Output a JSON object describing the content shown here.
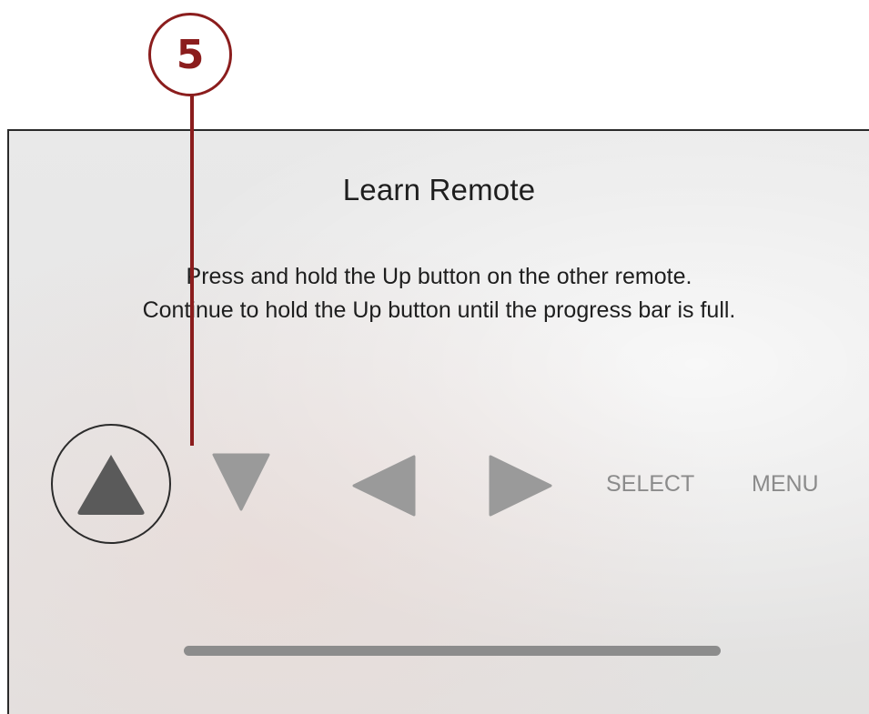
{
  "callout": {
    "number": "5"
  },
  "screen": {
    "title": "Learn Remote",
    "instructions": [
      "Press and hold the Up button on the other remote.",
      "Continue to hold the Up button until the progress bar is full."
    ]
  },
  "controls": {
    "items": [
      {
        "name": "up",
        "icon": "up-triangle-icon",
        "state": "active"
      },
      {
        "name": "down",
        "icon": "down-triangle-icon",
        "state": "inactive"
      },
      {
        "name": "left",
        "icon": "left-triangle-icon",
        "state": "inactive"
      },
      {
        "name": "right",
        "icon": "right-triangle-icon",
        "state": "inactive"
      }
    ],
    "select_label": "SELECT",
    "menu_label": "MENU"
  },
  "progress": {
    "value": 0.0
  },
  "colors": {
    "callout": "#8b1d1d",
    "active_icon": "#5a5a5a",
    "inactive_icon": "#9a9a9a",
    "progress_bar": "#8c8c8c",
    "text": "#1e1e1e"
  }
}
